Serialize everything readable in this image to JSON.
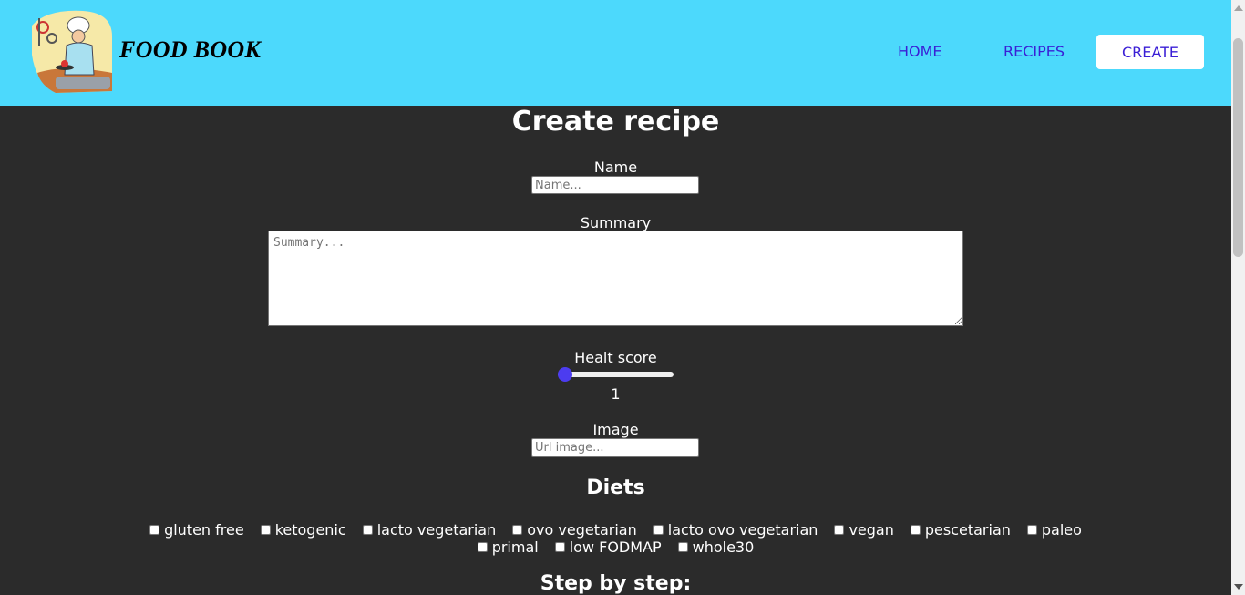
{
  "navbar": {
    "brand": "FOOD BOOK",
    "links": [
      "HOME",
      "RECIPES",
      "CREATE"
    ],
    "bg_color": "#4cd9fc",
    "link_color": "#3a1fd6"
  },
  "form": {
    "title": "Create recipe",
    "name": {
      "label": "Name",
      "placeholder": "Name..."
    },
    "summary": {
      "label": "Summary",
      "placeholder": "Summary..."
    },
    "health_score": {
      "label": "Healt score",
      "value": "1",
      "min": 1,
      "max": 100
    },
    "image": {
      "label": "Image",
      "placeholder": "Url image..."
    },
    "diets": {
      "title": "Diets",
      "row1": [
        "gluten free",
        "ketogenic",
        "lacto vegetarian",
        "ovo vegetarian",
        "lacto ovo vegetarian",
        "vegan",
        "pescetarian",
        "paleo"
      ],
      "row2": [
        "primal",
        "low FODMAP",
        "whole30"
      ]
    },
    "steps_title": "Step by step:"
  },
  "colors": {
    "page_bg": "#2b2b2b",
    "slider_thumb": "#4c3cf0"
  }
}
